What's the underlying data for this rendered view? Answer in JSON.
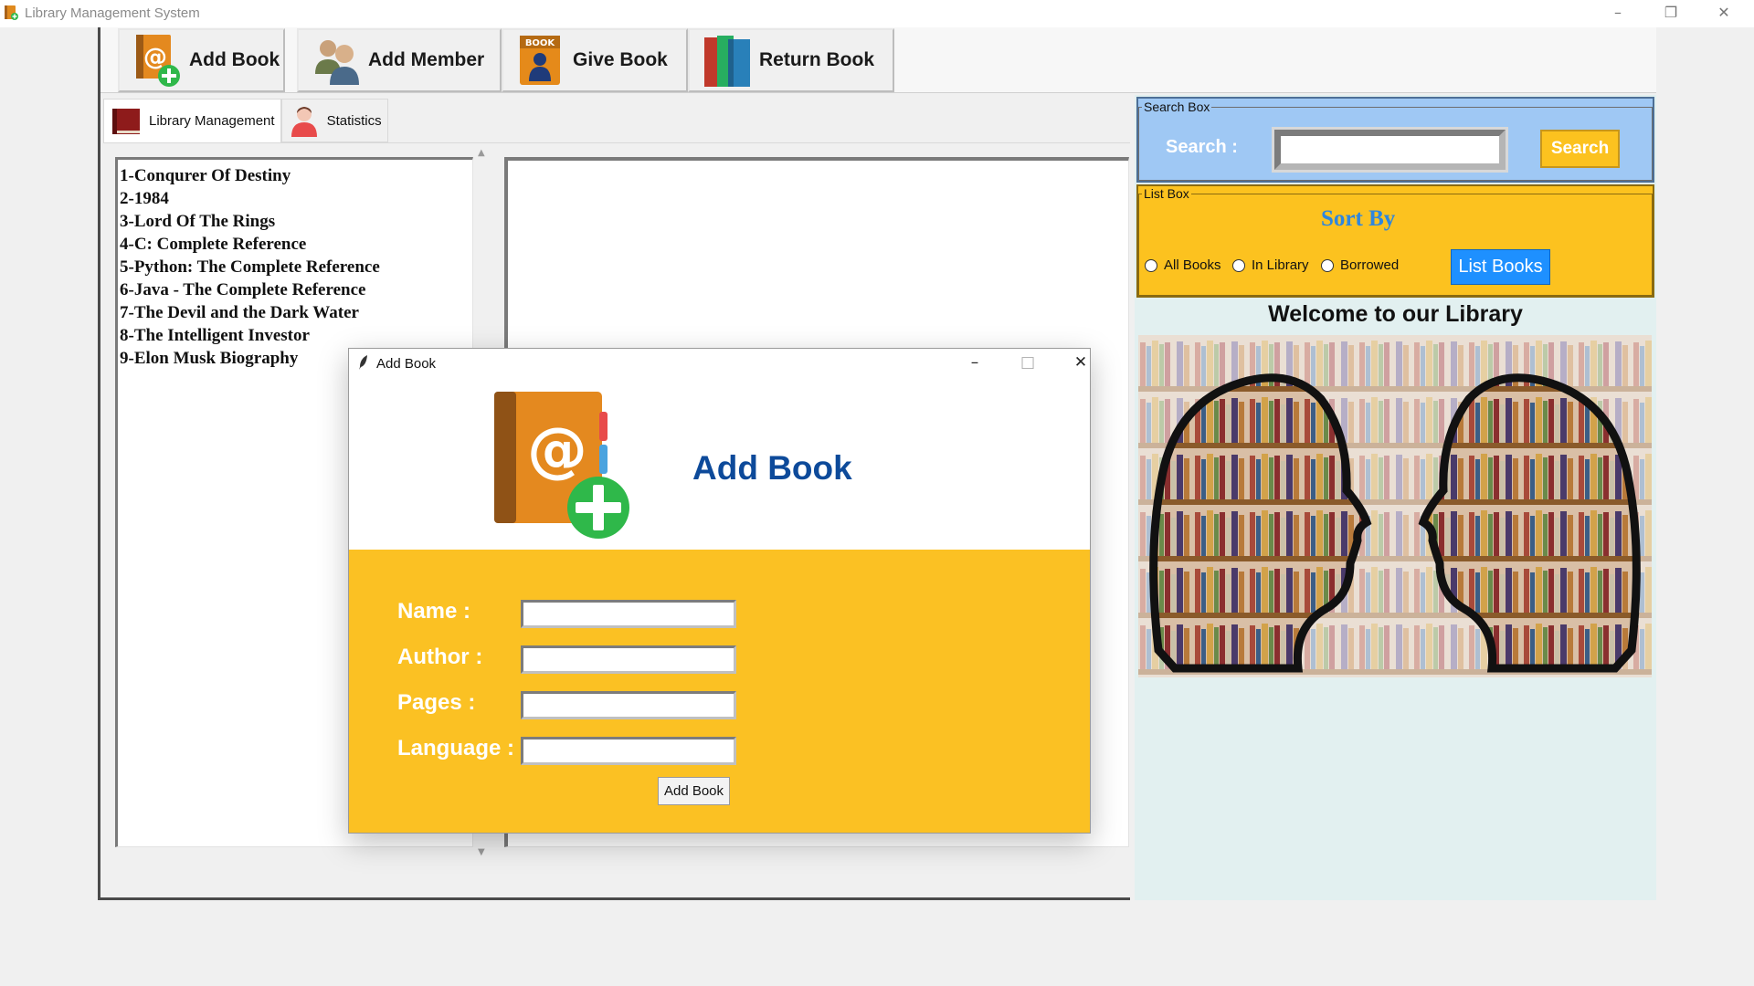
{
  "window": {
    "title": "Library Management System",
    "controls": [
      "minimize",
      "restore",
      "close"
    ]
  },
  "toolbar": {
    "buttons": [
      {
        "label": "Add Book",
        "icon": "address-book-add-icon"
      },
      {
        "label": "Add Member",
        "icon": "users-icon"
      },
      {
        "label": "Give Book",
        "icon": "book-person-icon"
      },
      {
        "label": "Return Book",
        "icon": "books-stack-icon"
      }
    ]
  },
  "tabs": [
    {
      "label": "Library Management",
      "icon": "book-icon",
      "active": true
    },
    {
      "label": "Statistics",
      "icon": "person-icon",
      "active": false
    }
  ],
  "books": [
    "1-Conqurer Of Destiny",
    "2-1984",
    "3-Lord Of The Rings",
    "4-C: Complete Reference",
    "5-Python: The Complete Reference",
    "6-Java - The Complete Reference",
    "7-The Devil and the Dark Water",
    "8-The Intelligent Investor",
    "9-Elon Musk Biography"
  ],
  "search_box": {
    "group_label": "Search Box",
    "label": "Search :",
    "value": "",
    "button": "Search"
  },
  "list_box": {
    "group_label": "List Box",
    "sort_by": "Sort By",
    "options": [
      "All Books",
      "In Library",
      "Borrowed"
    ],
    "button": "List Books"
  },
  "welcome": "Welcome to our Library",
  "dialog": {
    "title": "Add Book",
    "header": "Add Book",
    "fields": [
      {
        "label": "Name :",
        "value": ""
      },
      {
        "label": "Author :",
        "value": ""
      },
      {
        "label": "Pages :",
        "value": ""
      },
      {
        "label": "Language :",
        "value": ""
      }
    ],
    "submit": "Add Book"
  },
  "colors": {
    "search_bg": "#9fc8f4",
    "yellow": "#fbc123",
    "blue_button": "#1e90ff",
    "dialog_title": "#0d4a9a",
    "sort_by": "#2e86de"
  }
}
